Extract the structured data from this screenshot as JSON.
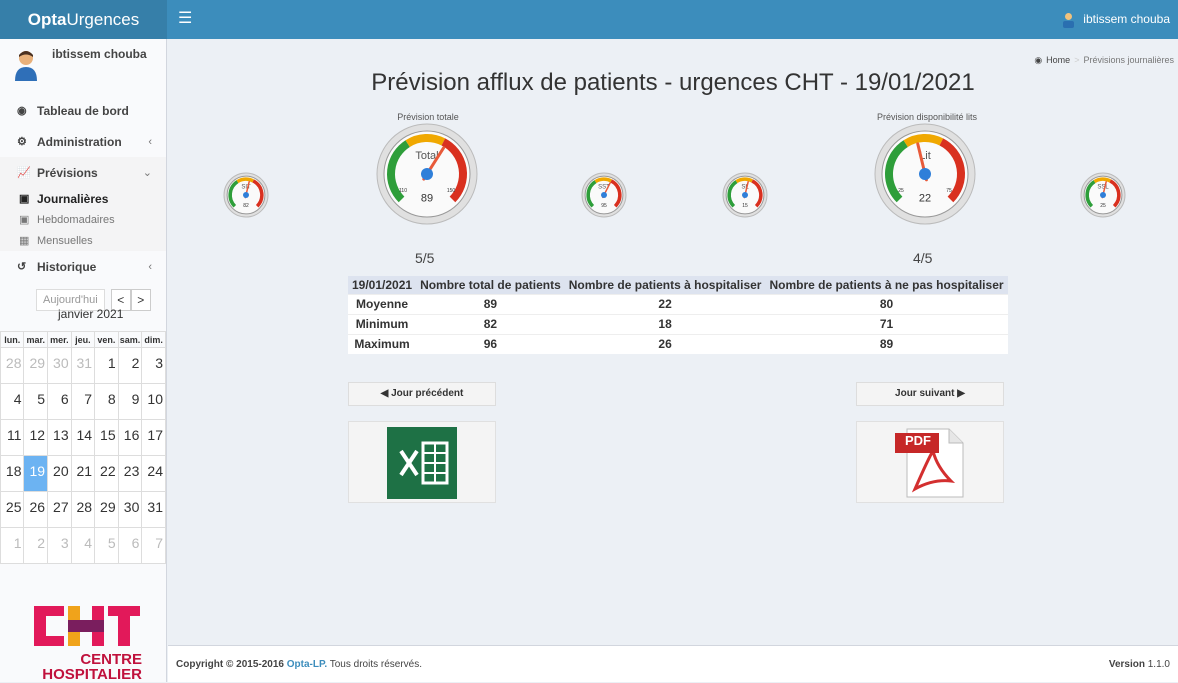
{
  "header": {
    "brand_bold": "Opta",
    "brand_rest": "Urgences",
    "menu_icon": "☰",
    "user_name": "ibtissem chouba"
  },
  "sidebar": {
    "user_name": "ibtissem chouba",
    "items": [
      {
        "icon": "dashboard-icon",
        "label": "Tableau de bord"
      },
      {
        "icon": "cogs-icon",
        "label": "Administration"
      },
      {
        "icon": "line-chart-icon",
        "label": "Prévisions"
      },
      {
        "icon": "history-icon",
        "label": "Historique"
      }
    ],
    "subitems": [
      {
        "icon": "calendar-day-icon",
        "label": "Journalières"
      },
      {
        "icon": "calendar-week-icon",
        "label": "Hebdomadaires"
      },
      {
        "icon": "calendar-month-icon",
        "label": "Mensuelles"
      }
    ],
    "calendar": {
      "today_label": "Aujourd'hui",
      "prev": "<",
      "next": ">",
      "title": "janvier 2021",
      "weekdays": [
        "lun.",
        "mar.",
        "mer.",
        "jeu.",
        "ven.",
        "sam.",
        "dim."
      ],
      "weeks": [
        [
          "28",
          "29",
          "30",
          "31",
          "1",
          "2",
          "3"
        ],
        [
          "4",
          "5",
          "6",
          "7",
          "8",
          "9",
          "10"
        ],
        [
          "11",
          "12",
          "13",
          "14",
          "15",
          "16",
          "17"
        ],
        [
          "18",
          "19",
          "20",
          "21",
          "22",
          "23",
          "24"
        ],
        [
          "25",
          "26",
          "27",
          "28",
          "29",
          "30",
          "31"
        ],
        [
          "1",
          "2",
          "3",
          "4",
          "5",
          "6",
          "7"
        ]
      ],
      "selected": "19"
    },
    "logo_text_1": "CENTRE",
    "logo_text_2": "HOSPITALIER"
  },
  "breadcrumb": {
    "home": "Home",
    "current": "Prévisions journalières"
  },
  "main": {
    "title": "Prévision afflux de patients - urgences CHT - 19/01/2021",
    "label_total": "Prévision totale",
    "label_lits": "Prévision disponibilité lits",
    "score_total": "5/5",
    "score_lits": "4/5",
    "gauges": [
      {
        "id": "sit",
        "title": "SIT",
        "value": "82",
        "min": "",
        "max": "",
        "level": 0.55
      },
      {
        "id": "total",
        "title": "Total",
        "value": "89",
        "min": "110",
        "max": "150",
        "level": 0.62
      },
      {
        "id": "sst",
        "title": "SST",
        "value": "95",
        "min": "",
        "max": "",
        "level": 0.6
      },
      {
        "id": "sl",
        "title": "SL",
        "value": "15",
        "min": "",
        "max": "",
        "level": 0.55
      },
      {
        "id": "lit",
        "title": "Lit",
        "value": "22",
        "min": "25",
        "max": "75",
        "level": 0.45
      },
      {
        "id": "ssl",
        "title": "SSL",
        "value": "25",
        "min": "",
        "max": "",
        "level": 0.55
      }
    ],
    "table": {
      "headers": [
        "19/01/2021",
        "Nombre total de patients",
        "Nombre de patients à hospitaliser",
        "Nombre de patients à ne pas hospitaliser"
      ],
      "rows": [
        [
          "Moyenne",
          "89",
          "22",
          "80"
        ],
        [
          "Minimum",
          "82",
          "18",
          "71"
        ],
        [
          "Maximum",
          "96",
          "26",
          "89"
        ]
      ]
    },
    "prev_button": "◀ Jour précédent",
    "next_button": "Jour suivant ▶",
    "excel_icon": "excel-icon",
    "pdf_label": "PDF"
  },
  "footer": {
    "copyright": "Copyright © 2015-2016 ",
    "company": "Opta-LP.",
    "rights": " Tous droits réservés.",
    "version_label": "Version",
    "version": " 1.1.0"
  }
}
